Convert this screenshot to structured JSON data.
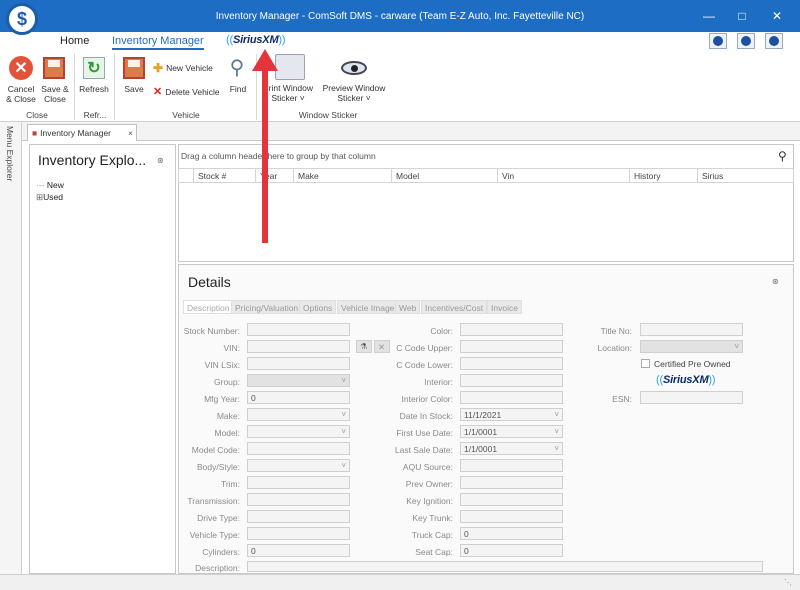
{
  "window": {
    "title": "Inventory Manager - ComSoft DMS - carware (Team E-Z Auto, Inc. Fayetteville NC)",
    "logo_letter": "$"
  },
  "menu": {
    "home": "Home",
    "inventory_manager": "Inventory Manager",
    "sirius": "SiriusXM"
  },
  "ribbon": {
    "cancel_close": [
      "Cancel",
      "& Close"
    ],
    "save_close": [
      "Save &",
      "Close"
    ],
    "refresh": "Refresh",
    "save": "Save",
    "new_vehicle": "New Vehicle",
    "delete_vehicle": "Delete Vehicle",
    "find": "Find",
    "print_sticker": [
      "Print Window",
      "Sticker"
    ],
    "preview_sticker": [
      "Preview Window",
      "Sticker"
    ],
    "groups": {
      "close": "Close",
      "refresh": "Refr...",
      "vehicle": "Vehicle",
      "window_sticker": "Window Sticker"
    }
  },
  "doc_tab": "Inventory Manager",
  "left_rail": "Menu Explorer",
  "explorer": {
    "title": "Inventory Explo...",
    "items": [
      "New",
      "Used"
    ]
  },
  "grid": {
    "group_hint": "Drag a column header here to group by that column",
    "columns": [
      "Stock #",
      "Year",
      "Make",
      "Model",
      "Vin",
      "History",
      "Sirius"
    ]
  },
  "details": {
    "title": "Details",
    "tabs": [
      "Description",
      "Pricing/Valuation",
      "Options",
      "Vehicle Image",
      "Web",
      "Incentives/Cost",
      "Invoice"
    ],
    "col1": {
      "stock_number": "Stock Number:",
      "vin": "VIN:",
      "vin_lsix": "VIN LSix:",
      "group": "Group:",
      "mfg_year": "Mfg Year:",
      "make": "Make:",
      "model": "Model:",
      "model_code": "Model Code:",
      "body_style": "Body/Style:",
      "trim": "Trim:",
      "transmission": "Transmission:",
      "drive_type": "Drive Type:",
      "vehicle_type": "Vehicle Type:",
      "cylinders": "Cylinders:",
      "description": "Description:"
    },
    "col1_values": {
      "mfg_year": "0",
      "cylinders": "0"
    },
    "col2": {
      "color": "Color:",
      "c_code_upper": "C Code Upper:",
      "c_code_lower": "C Code Lower:",
      "interior": "Interior:",
      "interior_color": "Interior Color:",
      "date_in_stock": "Date In Stock:",
      "first_use_date": "First Use Date:",
      "last_sale_date": "Last Sale Date:",
      "aqu_source": "AQU Source:",
      "prev_owner": "Prev Owner:",
      "key_ignition": "Key Ignition:",
      "key_trunk": "Key Trunk:",
      "truck_cap": "Truck Cap:",
      "seat_cap": "Seat Cap:"
    },
    "col2_values": {
      "date_in_stock": "11/1/2021",
      "first_use_date": "1/1/0001",
      "last_sale_date": "1/1/0001",
      "truck_cap": "0",
      "seat_cap": "0"
    },
    "col3": {
      "title_no": "Title No:",
      "location": "Location:",
      "certified": "Certified Pre Owned",
      "sirius": "SiriusXM",
      "esn": "ESN:"
    }
  }
}
